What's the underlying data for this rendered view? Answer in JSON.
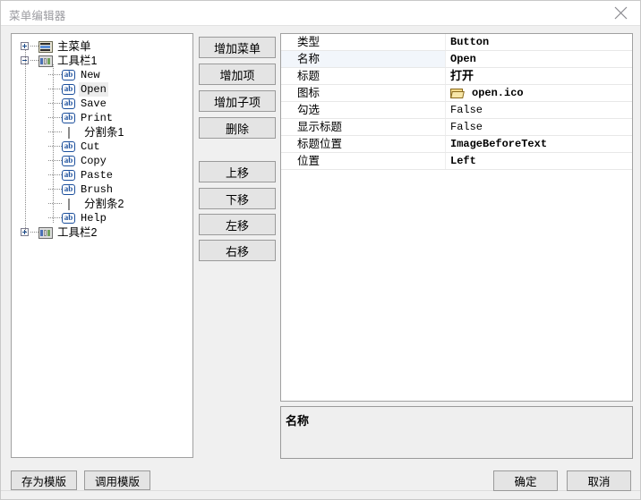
{
  "window": {
    "title": "菜单编辑器",
    "close_icon": "close-icon"
  },
  "tree": {
    "nodes": [
      {
        "label": "主菜单",
        "icon": "menu-icon",
        "depth": 0,
        "expander": "plus",
        "selected": false,
        "script": "cjk"
      },
      {
        "label": "工具栏1",
        "icon": "toolbar-icon",
        "depth": 0,
        "expander": "minus",
        "selected": false,
        "script": "cjk"
      },
      {
        "label": "New",
        "icon": "ab-icon",
        "depth": 1,
        "expander": "none",
        "selected": false,
        "script": "mono"
      },
      {
        "label": "Open",
        "icon": "ab-icon",
        "depth": 1,
        "expander": "none",
        "selected": true,
        "script": "mono"
      },
      {
        "label": "Save",
        "icon": "ab-icon",
        "depth": 1,
        "expander": "none",
        "selected": false,
        "script": "mono"
      },
      {
        "label": "Print",
        "icon": "ab-icon",
        "depth": 1,
        "expander": "none",
        "selected": false,
        "script": "mono"
      },
      {
        "label": "分割条1",
        "icon": "separator-icon",
        "depth": 1,
        "expander": "none",
        "selected": false,
        "script": "cjk"
      },
      {
        "label": "Cut",
        "icon": "ab-icon",
        "depth": 1,
        "expander": "none",
        "selected": false,
        "script": "mono"
      },
      {
        "label": "Copy",
        "icon": "ab-icon",
        "depth": 1,
        "expander": "none",
        "selected": false,
        "script": "mono"
      },
      {
        "label": "Paste",
        "icon": "ab-icon",
        "depth": 1,
        "expander": "none",
        "selected": false,
        "script": "mono"
      },
      {
        "label": "Brush",
        "icon": "ab-icon",
        "depth": 1,
        "expander": "none",
        "selected": false,
        "script": "mono"
      },
      {
        "label": "分割条2",
        "icon": "separator-icon",
        "depth": 1,
        "expander": "none",
        "selected": false,
        "script": "cjk"
      },
      {
        "label": "Help",
        "icon": "ab-icon",
        "depth": 1,
        "expander": "none",
        "selected": false,
        "script": "mono"
      },
      {
        "label": "工具栏2",
        "icon": "toolbar-icon",
        "depth": 0,
        "expander": "plus",
        "selected": false,
        "script": "cjk"
      }
    ]
  },
  "actions": {
    "add_menu": "增加菜单",
    "add_item": "增加项",
    "add_subitem": "增加子项",
    "delete": "删除",
    "move_up": "上移",
    "move_down": "下移",
    "move_left": "左移",
    "move_right": "右移"
  },
  "template_actions": {
    "save_as_template": "存为模版",
    "load_template": "调用模版"
  },
  "properties": {
    "rows": [
      {
        "name": "类型",
        "value": "Button",
        "value_script": "mono",
        "bold": true,
        "icon": null,
        "selected": false
      },
      {
        "name": "名称",
        "value": "Open",
        "value_script": "mono",
        "bold": true,
        "icon": null,
        "selected": true
      },
      {
        "name": "标题",
        "value": "打开",
        "value_script": "cjk",
        "bold": true,
        "icon": null,
        "selected": false
      },
      {
        "name": "图标",
        "value": "open.ico",
        "value_script": "mono",
        "bold": true,
        "icon": "folder-open-icon",
        "selected": false
      },
      {
        "name": "勾选",
        "value": "False",
        "value_script": "mono",
        "bold": false,
        "icon": null,
        "selected": false
      },
      {
        "name": "显示标题",
        "value": "False",
        "value_script": "mono",
        "bold": false,
        "icon": null,
        "selected": false
      },
      {
        "name": "标题位置",
        "value": "ImageBeforeText",
        "value_script": "mono",
        "bold": true,
        "icon": null,
        "selected": false
      },
      {
        "name": "位置",
        "value": "Left",
        "value_script": "mono",
        "bold": true,
        "icon": null,
        "selected": false
      }
    ]
  },
  "description": {
    "title": "名称",
    "body": ""
  },
  "dialog_buttons": {
    "ok": "确定",
    "cancel": "取消"
  },
  "colors": {
    "window_bg": "#f0f0f0",
    "titlebar_bg": "#ffffff",
    "title_fg": "#9b9ba0",
    "panel_bg": "#ffffff",
    "panel_border": "#a0a0a0",
    "button_bg": "#e4e4e4",
    "button_border": "#9a9a9a",
    "selected_row_bg": "#f2f6fb",
    "tree_selected_bg": "#ededed",
    "tree_icon_accent": "#1b4f9c"
  }
}
